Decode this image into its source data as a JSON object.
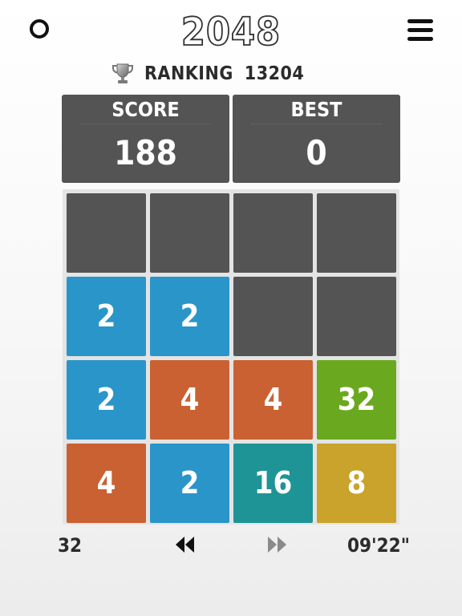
{
  "header": {
    "title": "2048",
    "ranking_label": "RANKING",
    "ranking_value": "13204",
    "trophy_icon": "trophy-icon",
    "left_icon": "circle-icon",
    "right_icon": "hamburger-menu-icon"
  },
  "scoreboard": {
    "score_label": "SCORE",
    "score_value": "188",
    "best_label": "BEST",
    "best_value": "0"
  },
  "board": {
    "rows": [
      [
        "",
        "",
        "",
        ""
      ],
      [
        "2",
        "2",
        "",
        ""
      ],
      [
        "2",
        "4",
        "4",
        "32"
      ],
      [
        "4",
        "2",
        "16",
        "8"
      ]
    ]
  },
  "tile_colors": {
    "empty": "#545454",
    "2": "#2a95c9",
    "4": "#c96132",
    "8": "#c9a32b",
    "16": "#1f9496",
    "32": "#6aa91f"
  },
  "footer": {
    "moves": "32",
    "timer": "09'22\"",
    "rewind_icon": "rewind-icon",
    "forward_icon": "fast-forward-icon",
    "rewind_color": "#111111",
    "forward_color": "#8a8a8a"
  }
}
